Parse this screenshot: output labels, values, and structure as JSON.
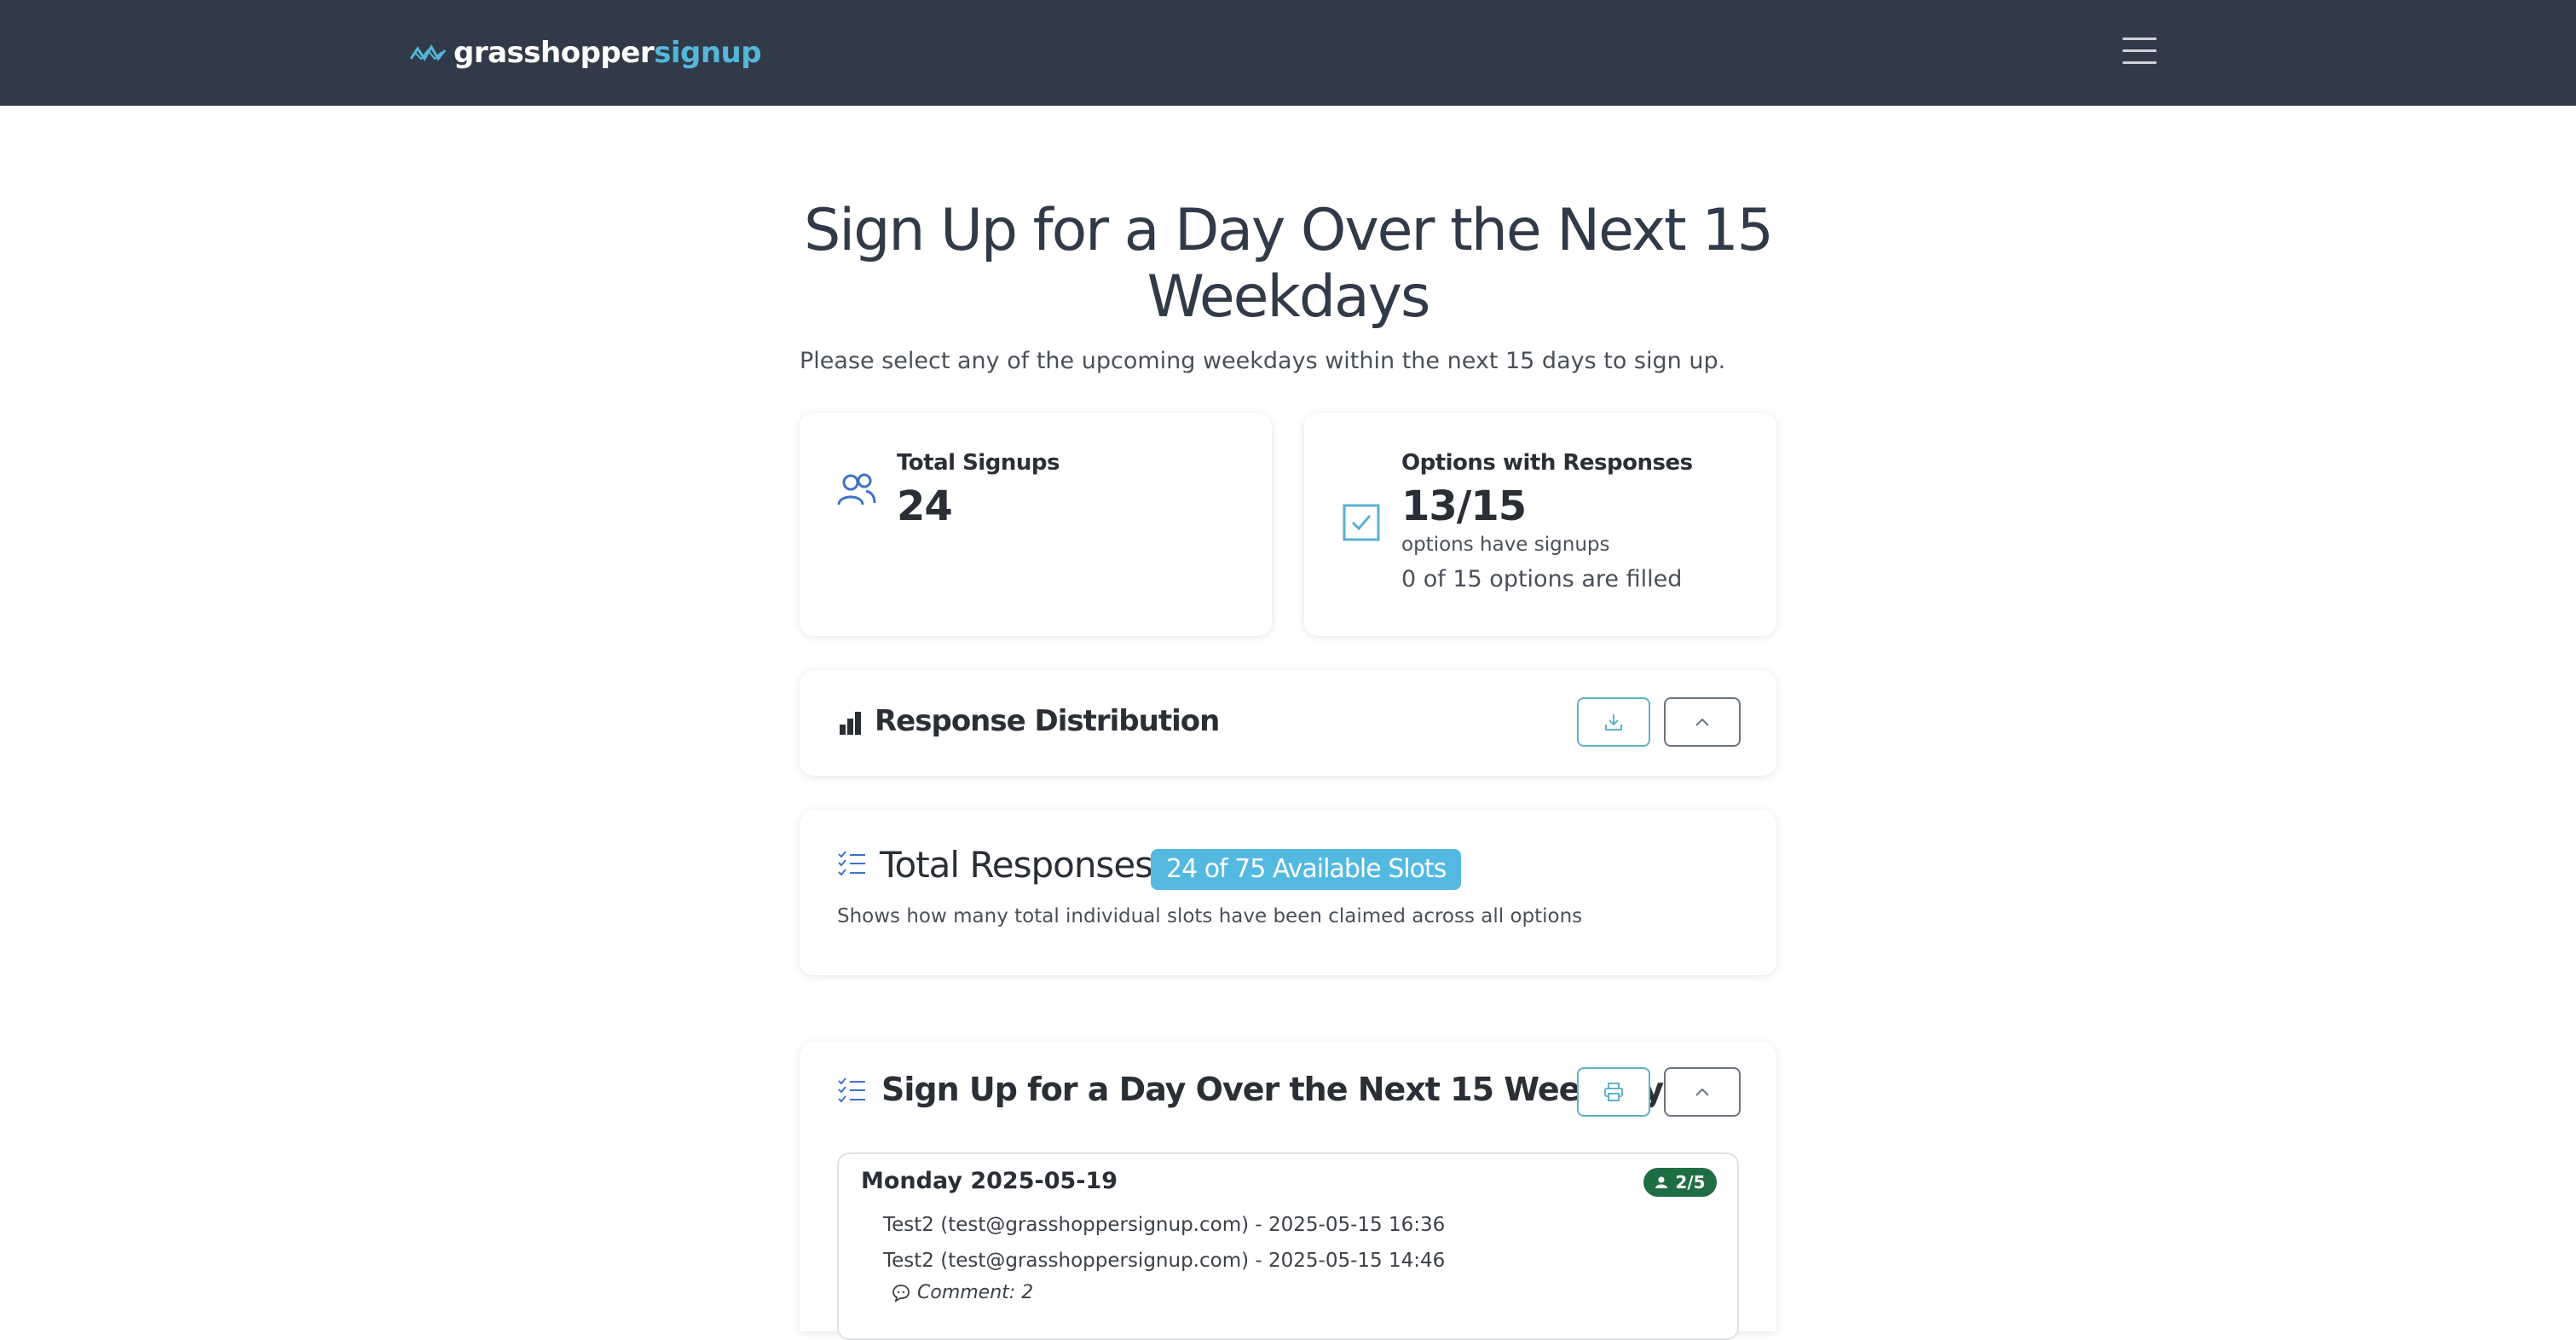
{
  "header": {
    "brand_primary": "grasshopper",
    "brand_secondary": "signup",
    "bg_color": "#313a48",
    "accent_color": "#54b6d8",
    "menu_icon": "hamburger-icon"
  },
  "page": {
    "title": "Sign Up for a Day Over the Next 15 Weekdays",
    "subtitle": "Please select any of the upcoming weekdays within the next 15 days to sign up."
  },
  "stats": {
    "signups": {
      "title": "Total Signups",
      "value": "24",
      "icon": "users-icon"
    },
    "options": {
      "title": "Options with Responses",
      "value": "13/15",
      "note": "options have signups",
      "note2": "0 of 15 options are filled",
      "icon": "check-square-icon"
    }
  },
  "distribution": {
    "title": "Response Distribution",
    "icon": "bar-chart-icon",
    "download_icon": "download-icon",
    "collapse_icon": "chevron-up-icon"
  },
  "responses": {
    "title": "Total Responses:",
    "badge": "24 of 75 Available Slots",
    "description": "Shows how many total individual slots have been claimed across all options",
    "icon": "list-check-icon"
  },
  "signup_list": {
    "title": "Sign Up for a Day Over the Next 15 Weekdays",
    "print_icon": "printer-icon",
    "collapse_icon": "chevron-up-icon",
    "days": [
      {
        "label": "Monday 2025-05-19",
        "count": "2/5",
        "entries": [
          "Test2 (test@grasshoppersignup.com) - 2025-05-15 16:36",
          "Test2 (test@grasshoppersignup.com) - 2025-05-15 14:46"
        ],
        "comment": "Comment: 2"
      }
    ]
  }
}
